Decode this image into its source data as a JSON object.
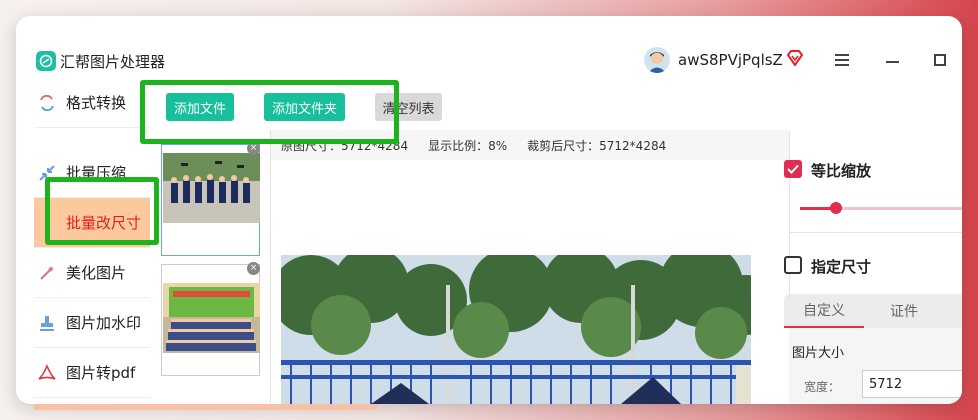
{
  "app": {
    "title": "汇帮图片处理器",
    "username": "awS8PVjPqlsZ"
  },
  "colors": {
    "accent": "#17c09a",
    "active_nav_bg": "#fbc99d",
    "active_nav_text": "#e02020",
    "checkbox": "#e02d50",
    "highlight": "#1db31d"
  },
  "sidebar": {
    "items": [
      {
        "label": "格式转换",
        "icon": "format-convert-icon"
      },
      {
        "label": "批量压缩",
        "icon": "compress-icon"
      },
      {
        "label": "批量改尺寸",
        "icon": "resize-icon",
        "active": true
      },
      {
        "label": "美化图片",
        "icon": "beautify-icon"
      },
      {
        "label": "图片加水印",
        "icon": "watermark-icon"
      },
      {
        "label": "图片转pdf",
        "icon": "pdf-icon"
      }
    ]
  },
  "toolbar": {
    "add_file": "添加文件",
    "add_folder": "添加文件夹",
    "clear_list": "清空列表"
  },
  "preview": {
    "original_size": "原图尺寸：5712*4284",
    "display_ratio": "显示比例：8%",
    "cropped_size": "裁剪后尺寸：5712*4284"
  },
  "settings": {
    "keep_ratio_label": "等比缩放",
    "keep_ratio_checked": true,
    "ratio_slider_value": 0.2,
    "custom_size_label": "指定尺寸",
    "custom_size_checked": false,
    "tabs": [
      "自定义",
      "证件"
    ],
    "image_size_title": "图片大小",
    "width_label": "宽度：",
    "width_value": "5712"
  }
}
